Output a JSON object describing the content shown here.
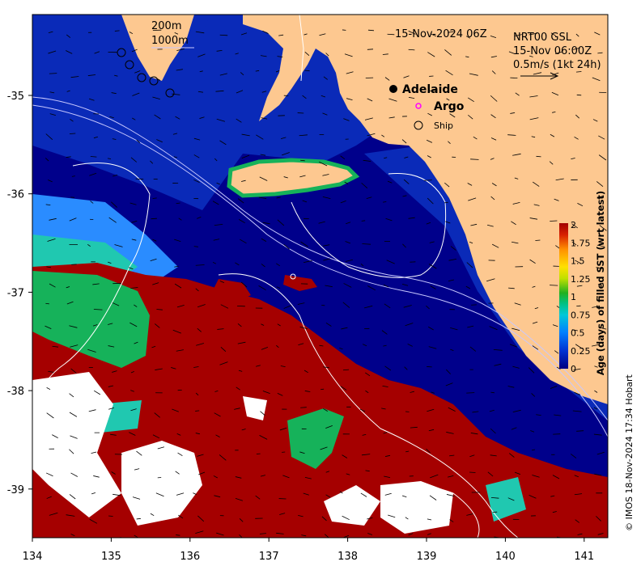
{
  "title": "15-Nov-2024 06Z",
  "depth_labels": [
    "200m",
    "1000m"
  ],
  "velocity_legend": {
    "line1": "NRT00 GSL",
    "line2": "15-Nov 06:00Z",
    "line3": "0.5m/s (1kt 24h)"
  },
  "markers": {
    "city": "Adelaide",
    "argo": "Argo",
    "ship": "Ship"
  },
  "x_ticks": [
    "134",
    "135",
    "136",
    "137",
    "138",
    "139",
    "140",
    "141"
  ],
  "y_ticks": [
    "-35",
    "-36",
    "-37",
    "-38",
    "-39"
  ],
  "colorbar": {
    "title": "Age (days) of filled SST (wrt latest)",
    "ticks": [
      "2",
      "1.75",
      "1.5",
      "1.25",
      "1",
      "0.75",
      "0.5",
      "0.25",
      "0"
    ],
    "colors": [
      "#000080",
      "#0044dd",
      "#00a0ff",
      "#00d0c0",
      "#20c040",
      "#80e020",
      "#ffe000",
      "#ff9000",
      "#e03000",
      "#a00000"
    ]
  },
  "credit": "© IMOS 18-Nov-2024 17:34 Hobart",
  "colors": {
    "land": "#fdc890",
    "ocean_deep": "#00008b",
    "ocean_mid": "#0a28b4",
    "old_sst": "#a50000",
    "green": "#16b25a",
    "cyan": "#20c8b0",
    "lightblue": "#2a8cff"
  }
}
